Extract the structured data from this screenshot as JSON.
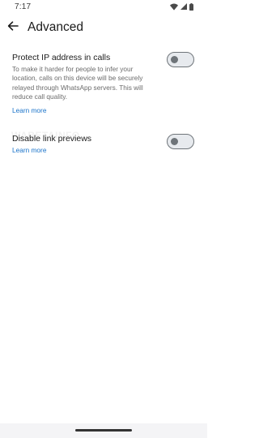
{
  "status_bar": {
    "time": "7:17",
    "icons": [
      "wifi-icon",
      "signal-icon",
      "battery-icon"
    ]
  },
  "app_bar": {
    "back_icon": "arrow-back-icon",
    "title": "Advanced"
  },
  "settings": [
    {
      "title": "Protect IP address in calls",
      "description": "To make it harder for people to infer your location, calls on this device will be securely relayed through WhatsApp servers. This will reduce call quality.",
      "link": "Learn more",
      "enabled": false
    },
    {
      "title": "Disable link previews",
      "link": "Learn more",
      "enabled": false
    }
  ],
  "watermark": "WABETAINFO",
  "colors": {
    "background": "#ffffff",
    "title_text": "#1b1b1b",
    "secondary_text": "#6b6b6b",
    "link": "#1a73c9",
    "toggle_off_track": "#e7eaee",
    "toggle_off_outline": "#6e7479",
    "nav_bar": "#f4f4f6"
  }
}
